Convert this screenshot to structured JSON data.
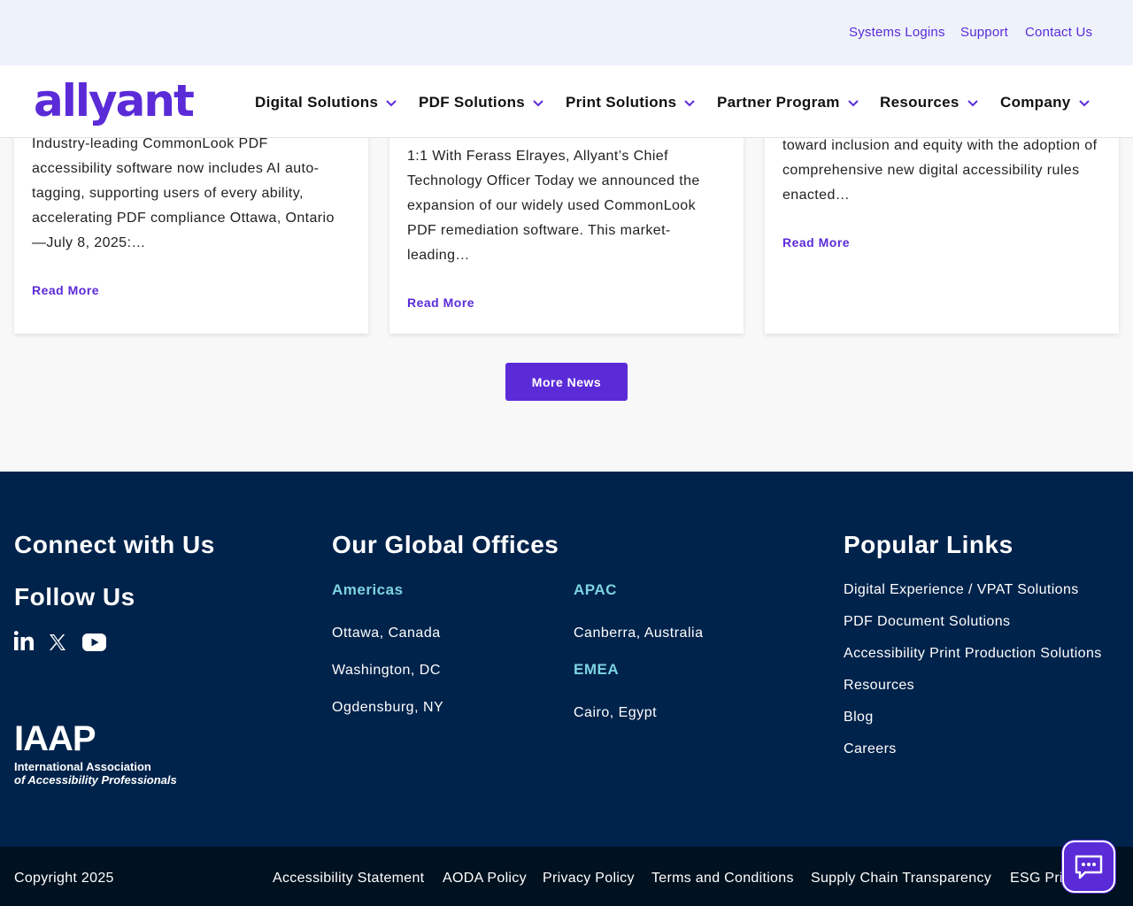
{
  "topbar": {
    "links": [
      "Systems Logins",
      "Support",
      "Contact Us"
    ]
  },
  "brand": {
    "logo_text": "allyant",
    "color": "#5b2bd8"
  },
  "nav": {
    "items": [
      "Digital Solutions",
      "PDF Solutions",
      "Print Solutions",
      "Partner Program",
      "Resources",
      "Company"
    ]
  },
  "news": {
    "cards": [
      {
        "excerpt": "Industry-leading CommonLook PDF accessibility software now includes AI auto-tagging, supporting users of every ability, accelerating PDF compliance Ottawa, Ontario —July 8, 2025:…",
        "link": "Read More"
      },
      {
        "excerpt": "1:1 With Ferass Elrayes, Allyant’s Chief Technology Officer  Today we announced the expansion of our widely used CommonLook PDF remediation software. This market-leading…",
        "link": "Read More"
      },
      {
        "excerpt": "toward inclusion and equity with the adoption of comprehensive new digital accessibility rules enacted…",
        "link": "Read More"
      }
    ],
    "more_button": "More News"
  },
  "footer": {
    "connect_heading": "Connect with Us",
    "follow_heading": "Follow Us",
    "social_icons": [
      "linkedin-icon",
      "x-icon",
      "youtube-icon"
    ],
    "iaap": {
      "mark": "IAAP",
      "line1": "International Association",
      "line2": "of Accessibility Professionals"
    },
    "offices_heading": "Our Global Offices",
    "americas": {
      "label": "Americas",
      "cities": [
        "Ottawa, Canada",
        "Washington, DC",
        "Ogdensburg, NY"
      ]
    },
    "apac": {
      "label": "APAC",
      "cities": [
        "Canberra, Australia"
      ]
    },
    "emea": {
      "label": "EMEA",
      "cities": [
        "Cairo, Egypt"
      ]
    },
    "popular_heading": "Popular Links",
    "popular_links": [
      "Digital Experience / VPAT Solutions",
      "PDF Document Solutions",
      "Accessibility Print Production Solutions",
      "Resources",
      "Blog",
      "Careers"
    ]
  },
  "bottom": {
    "copyright": "Copyright 2025",
    "links": [
      "Accessibility Statement",
      "AODA Policy",
      "Privacy Policy",
      "Terms and Conditions",
      "Supply Chain Transparency",
      "ESG Pri"
    ]
  },
  "chat": {
    "icon": "chat-icon"
  }
}
